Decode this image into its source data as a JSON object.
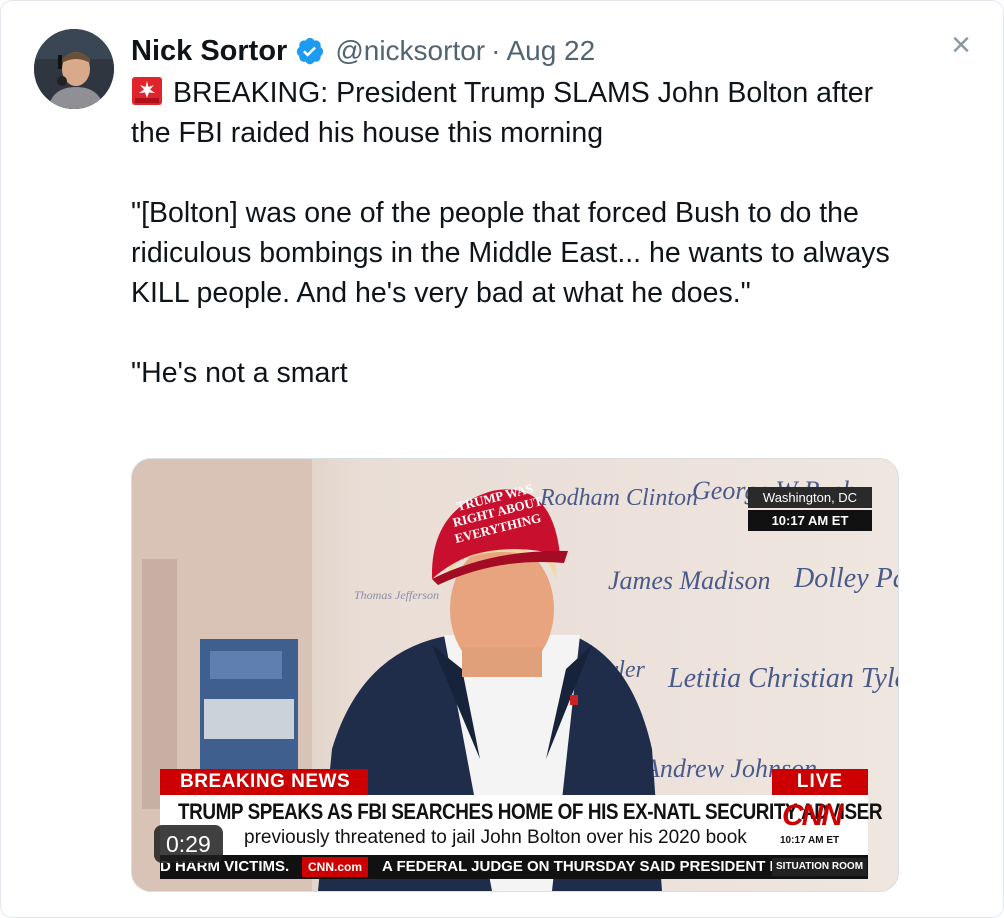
{
  "author": {
    "name": "Nick Sortor",
    "handle": "@nicksortor",
    "separator": "·",
    "date": "Aug 22"
  },
  "close_icon": "×",
  "tweet": {
    "line1": "BREAKING: President Trump SLAMS John Bolton after the FBI raided his house this morning",
    "quote": "\"[Bolton] was one of the people that forced Bush to do the ridiculous bombings in the Middle East... he wants to always KILL people. And he's very bad at what he does.\"",
    "line3": "\"He's not a smart"
  },
  "video": {
    "duration": "0:29",
    "overlay": {
      "location": "Washington, DC",
      "time": "10:17 AM ET",
      "breaking": "BREAKING NEWS",
      "live": "LIVE",
      "headline": "TRUMP SPEAKS AS FBI SEARCHES HOME OF HIS EX-NATL SECURITY ADVISER",
      "subline": "previously threatened to jail John Bolton over his 2020 book",
      "network": "CNN",
      "network_time": "10:17 AM ET",
      "ticker_left": "D HARM VICTIMS.",
      "ticker_site": "CNN.com",
      "ticker_text": "A FEDERAL JUDGE ON THURSDAY SAID PRESIDENT DO",
      "ticker_show": "SITUATION ROOM"
    },
    "wall_names": [
      "Rodham Clinton",
      "George W Bush",
      "James Madison",
      "Dolley Pa",
      "Letitia Christian Tyler",
      "Tyler",
      "Andrew Johnson",
      "Thomas Jefferson"
    ],
    "hat_text": [
      "TRUMP WAS",
      "RIGHT ABOUT",
      "EVERYTHING"
    ]
  },
  "colors": {
    "verified": "#1d9bf0",
    "handle": "#536471",
    "cnn_red": "#cc0000"
  }
}
